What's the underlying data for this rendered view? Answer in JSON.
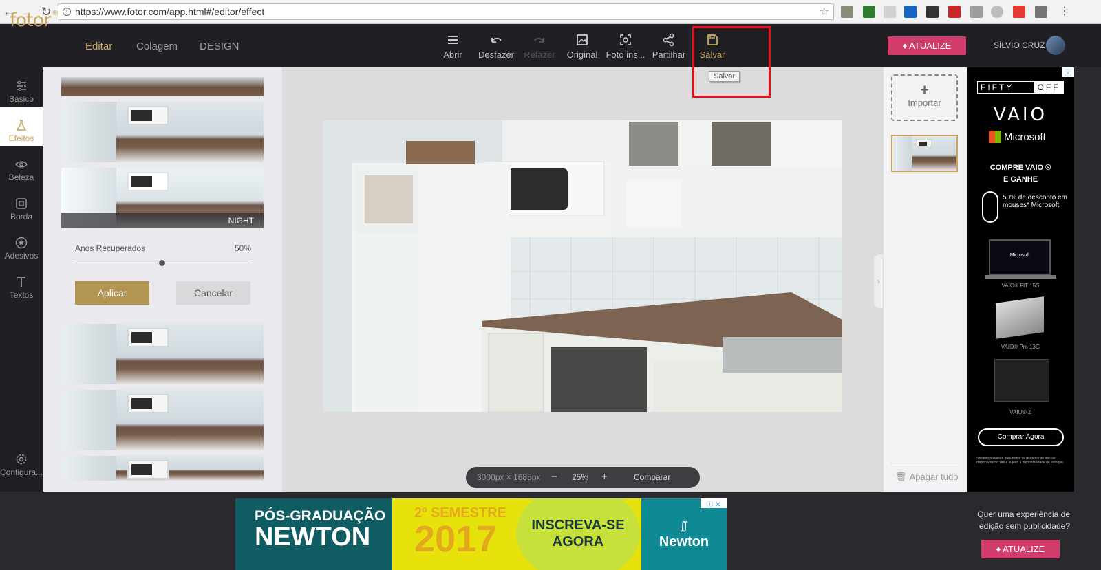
{
  "browser": {
    "url": "https://www.fotor.com/app.html#/editor/effect",
    "back_icon": "back-arrow-icon",
    "forward_icon": "forward-arrow-icon",
    "reload_icon": "reload-icon",
    "menu_icon": "kebab-menu-icon"
  },
  "header": {
    "logo": "fotor",
    "logo_mark": "®",
    "nav": [
      "Editar",
      "Colagem",
      "DESIGN"
    ],
    "tools": [
      {
        "label": "Abrir",
        "icon": "menu-icon"
      },
      {
        "label": "Desfazer",
        "icon": "undo-icon"
      },
      {
        "label": "Refazer",
        "icon": "redo-icon"
      },
      {
        "label": "Original",
        "icon": "image-icon"
      },
      {
        "label": "Foto ins...",
        "icon": "camera-frame-icon"
      },
      {
        "label": "Partilhar",
        "icon": "share-icon"
      },
      {
        "label": "Salvar",
        "icon": "save-icon"
      }
    ],
    "tooltip": "Salvar",
    "upgrade_label": "ATUALIZE",
    "user_name": "SÍLVIO CRUZ"
  },
  "sidebar": {
    "items": [
      {
        "label": "Básico",
        "icon": "sliders-icon"
      },
      {
        "label": "Efeitos",
        "icon": "flask-icon"
      },
      {
        "label": "Beleza",
        "icon": "eye-icon"
      },
      {
        "label": "Borda",
        "icon": "frame-icon"
      },
      {
        "label": "Adesivos",
        "icon": "star-icon"
      },
      {
        "label": "Textos",
        "icon": "text-icon"
      }
    ],
    "settings_label": "Configura..."
  },
  "effects_panel": {
    "selected_effect": "NIGHT",
    "slider_label": "Anos Recuperados",
    "slider_value": "50%",
    "slider_level": 0.5,
    "apply_label": "Aplicar",
    "cancel_label": "Cancelar"
  },
  "canvas": {
    "dimensions": "3000px × 1685px",
    "zoom_out": "−",
    "zoom": "25%",
    "zoom_in": "+",
    "compare_label": "Comparar"
  },
  "right_panel": {
    "import_plus": "+",
    "import_label": "Importar",
    "clear_label": "Apagar tudo"
  },
  "ad_right": {
    "fifty": "FIFTY",
    "off": "OFF",
    "vaio": "VAIO",
    "microsoft": "Microsoft",
    "line1": "COMPRE VAIO ®",
    "line2": "E GANHE",
    "promo": "50% de desconto em mouses* Microsoft",
    "screen_label": "Microsoft",
    "laptop1": "VAIO® FIT 15S",
    "laptop2": "VAIO® Pro 13G",
    "laptop3": "VAIO® Z",
    "cta": "Comprar Agora",
    "fineprint": "*Promoção válida para todos os modelos de mouse disponíveis no site e sujeito à disponibilidade de estoque."
  },
  "ad_bottom": {
    "pos": "PÓS-GRADUAÇÃO",
    "newton": "NEWTON",
    "semester": "2º SEMESTRE",
    "year": "2017",
    "cta1": "INSCREVA-SE",
    "cta2": "AGORA",
    "brand": "Newton"
  },
  "bottom_right": {
    "question": "Quer uma experiência de edição sem publicidade?",
    "upgrade_label": "ATUALIZE"
  },
  "colors": {
    "accent": "#c8a55a",
    "upgrade": "#d13c6b",
    "highlight_box": "#e0131a",
    "dark_bg": "#1f1f24"
  }
}
